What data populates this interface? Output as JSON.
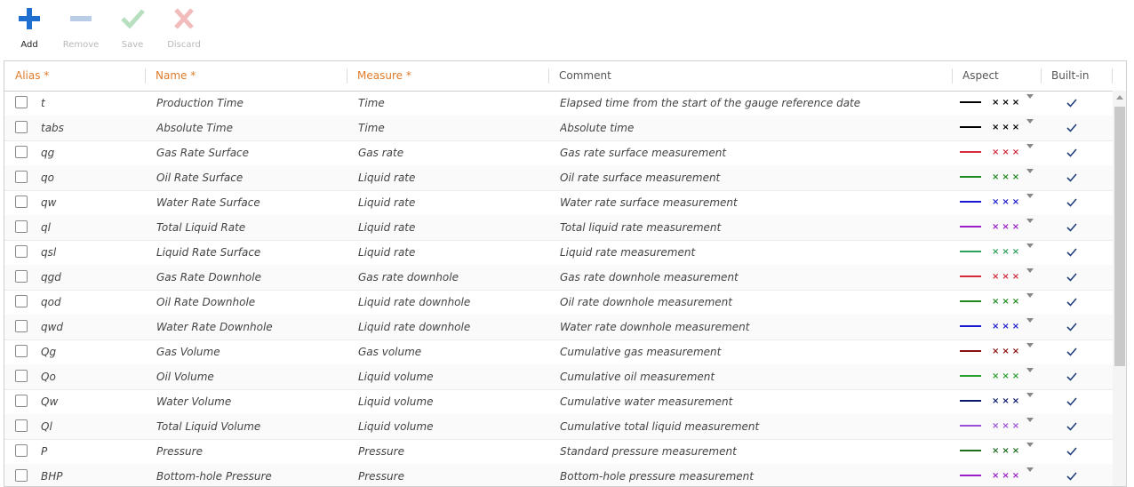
{
  "toolbar": {
    "add": "Add",
    "remove": "Remove",
    "save": "Save",
    "discard": "Discard"
  },
  "columns": {
    "alias": "Alias *",
    "name": "Name *",
    "measure": "Measure *",
    "comment": "Comment",
    "aspect": "Aspect",
    "builtin": "Built-in"
  },
  "rows": [
    {
      "alias": "t",
      "name": "Production Time",
      "measure": "Time",
      "comment": "Elapsed time from the start of the gauge reference date",
      "line": "#000000",
      "mark": "#000000",
      "builtin": true
    },
    {
      "alias": "tabs",
      "name": "Absolute Time",
      "measure": "Time",
      "comment": "Absolute time",
      "line": "#000000",
      "mark": "#000000",
      "builtin": true
    },
    {
      "alias": "qg",
      "name": "Gas Rate Surface",
      "measure": "Gas rate",
      "comment": "Gas rate surface measurement",
      "line": "#d42a3c",
      "mark": "#d42a3c",
      "builtin": true
    },
    {
      "alias": "qo",
      "name": "Oil Rate Surface",
      "measure": "Liquid rate",
      "comment": "Oil rate surface measurement",
      "line": "#1e8a1e",
      "mark": "#1e8a1e",
      "builtin": true
    },
    {
      "alias": "qw",
      "name": "Water Rate Surface",
      "measure": "Liquid rate",
      "comment": "Water rate surface measurement",
      "line": "#1a1ad0",
      "mark": "#1a1ad0",
      "builtin": true
    },
    {
      "alias": "ql",
      "name": "Total Liquid Rate",
      "measure": "Liquid rate",
      "comment": "Total liquid rate measurement",
      "line": "#9b1fc7",
      "mark": "#9b1fc7",
      "builtin": true
    },
    {
      "alias": "qsl",
      "name": "Liquid Rate Surface",
      "measure": "Liquid rate",
      "comment": "Liquid rate measurement",
      "line": "#2e9e5a",
      "mark": "#2e9e5a",
      "builtin": true
    },
    {
      "alias": "qgd",
      "name": "Gas Rate Downhole",
      "measure": "Gas rate downhole",
      "comment": "Gas rate downhole measurement",
      "line": "#d42a3c",
      "mark": "#d42a3c",
      "builtin": true
    },
    {
      "alias": "qod",
      "name": "Oil Rate Downhole",
      "measure": "Liquid rate downhole",
      "comment": "Oil rate downhole measurement",
      "line": "#1e8a1e",
      "mark": "#1e8a1e",
      "builtin": true
    },
    {
      "alias": "qwd",
      "name": "Water Rate Downhole",
      "measure": "Liquid rate downhole",
      "comment": "Water rate downhole measurement",
      "line": "#1a1ad0",
      "mark": "#1a1ad0",
      "builtin": true
    },
    {
      "alias": "Qg",
      "name": "Gas Volume",
      "measure": "Gas volume",
      "comment": "Cumulative gas measurement",
      "line": "#8a1010",
      "mark": "#8a1010",
      "builtin": true
    },
    {
      "alias": "Qo",
      "name": "Oil Volume",
      "measure": "Liquid volume",
      "comment": "Cumulative oil measurement",
      "line": "#2aa02a",
      "mark": "#2aa02a",
      "builtin": true
    },
    {
      "alias": "Qw",
      "name": "Water Volume",
      "measure": "Liquid volume",
      "comment": "Cumulative water measurement",
      "line": "#0c1a6b",
      "mark": "#0c1a6b",
      "builtin": true
    },
    {
      "alias": "Ql",
      "name": "Total Liquid Volume",
      "measure": "Liquid volume",
      "comment": "Cumulative total liquid measurement",
      "line": "#9b4fd6",
      "mark": "#9b4fd6",
      "builtin": true
    },
    {
      "alias": "P",
      "name": "Pressure",
      "measure": "Pressure",
      "comment": "Standard pressure measurement",
      "line": "#1e6e1e",
      "mark": "#1e6e1e",
      "builtin": true
    },
    {
      "alias": "BHP",
      "name": "Bottom-hole Pressure",
      "measure": "Pressure",
      "comment": "Bottom-hole pressure measurement",
      "line": "#9b1fc7",
      "mark": "#9b1fc7",
      "builtin": true
    }
  ]
}
